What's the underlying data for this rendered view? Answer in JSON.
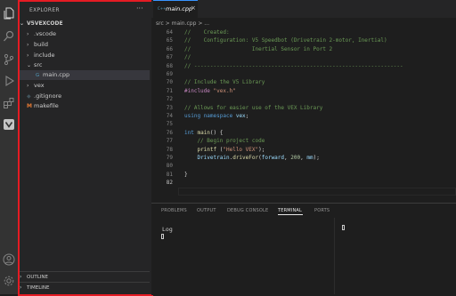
{
  "activity_bar": {
    "icons": [
      "files-icon",
      "search-icon",
      "source-control-icon",
      "run-debug-icon",
      "extensions-icon",
      "vex-icon",
      "account-icon",
      "settings-gear-icon"
    ]
  },
  "sidebar": {
    "title": "EXPLORER",
    "more": "···",
    "tree": [
      {
        "label": "V5VEXCODE",
        "type": "root",
        "expanded": true
      },
      {
        "label": ".vscode",
        "type": "folder",
        "expanded": false
      },
      {
        "label": "build",
        "type": "folder",
        "expanded": false
      },
      {
        "label": "include",
        "type": "folder",
        "expanded": false
      },
      {
        "label": "src",
        "type": "folder",
        "expanded": true
      },
      {
        "label": "main.cpp",
        "type": "cpp",
        "selected": true
      },
      {
        "label": "vex",
        "type": "folder",
        "expanded": false
      },
      {
        "label": ".gitignore",
        "type": "git"
      },
      {
        "label": "makefile",
        "type": "makefile",
        "icon": "M"
      }
    ],
    "outline": "OUTLINE",
    "timeline": "TIMELINE"
  },
  "editor": {
    "tab": {
      "label": "main.cpp",
      "icon": "C++",
      "close": "×"
    },
    "breadcrumb": "src > main.cpp > ...",
    "lines": [
      {
        "n": "64",
        "text": "//    Created:"
      },
      {
        "n": "65",
        "text": "//    Configuration: V5 Speedbot (Drivetrain 2-motor, Inertial)"
      },
      {
        "n": "66",
        "text": "//                   Inertial Sensor in Port 2"
      },
      {
        "n": "67",
        "text": "//"
      },
      {
        "n": "68",
        "text": "// -----------------------------------------------------------------"
      },
      {
        "n": "69",
        "text": ""
      },
      {
        "n": "70",
        "text": "// Include the V5 Library"
      },
      {
        "n": "71",
        "text": "#include \"vex.h\""
      },
      {
        "n": "72",
        "text": ""
      },
      {
        "n": "73",
        "text": "// Allows for easier use of the VEX Library"
      },
      {
        "n": "74",
        "text": "using namespace vex;"
      },
      {
        "n": "75",
        "text": ""
      },
      {
        "n": "76",
        "text": "int main() {"
      },
      {
        "n": "77",
        "text": "    // Begin project code"
      },
      {
        "n": "78",
        "text": "    printf (\"Hello VEX\");"
      },
      {
        "n": "79",
        "text": "    Drivetrain.driveFor(forward, 200, mm);"
      },
      {
        "n": "80",
        "text": ""
      },
      {
        "n": "81",
        "text": "}"
      },
      {
        "n": "82",
        "text": ""
      }
    ]
  },
  "panel": {
    "tabs": [
      "PROBLEMS",
      "OUTPUT",
      "DEBUG CONSOLE",
      "TERMINAL",
      "PORTS"
    ],
    "active_tab": "TERMINAL",
    "terminal_text": "Log"
  },
  "colors": {
    "highlight_border": "#e51b23",
    "comment": "#6a9955",
    "keyword": "#569cd6",
    "preprocessor": "#c586c0",
    "string": "#ce9178",
    "function": "#dcdcaa",
    "variable": "#9cdcfe"
  }
}
